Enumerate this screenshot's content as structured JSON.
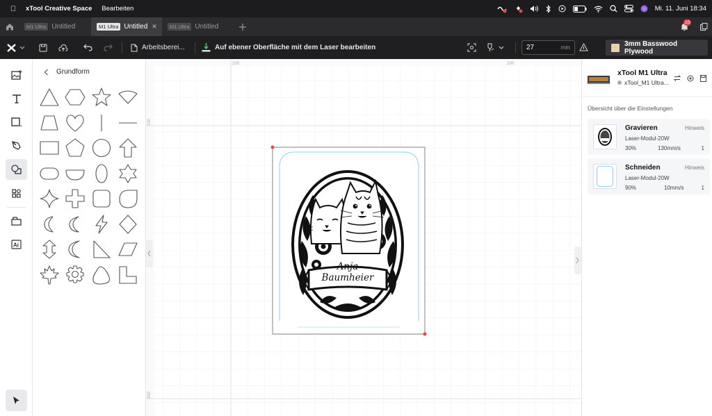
{
  "menubar": {
    "app_name": "xTool Creative Space",
    "menu_edit": "Bearbeiten",
    "clock": "Mi. 11. Juni  18:34"
  },
  "tabs": [
    {
      "badge": "M1 Ultra",
      "label": "Untitled"
    },
    {
      "badge": "M1 Ultra",
      "label": "Untitled",
      "close": "✕"
    },
    {
      "badge": "M1 Ultra",
      "label": "Untitled"
    }
  ],
  "notification_count": "10",
  "toolbar": {
    "workspace_label": "Arbeitsberei...",
    "mode_label": "Auf ebener Oberfläche mit dem Laser bearbeiten",
    "height_value": "27",
    "height_unit": "mm",
    "material_label": "3mm Basswood Plywood",
    "material_color": "#e8d2ad"
  },
  "shape_panel": {
    "title": "Grundform"
  },
  "rulers": {
    "top": [
      "100",
      "200"
    ],
    "left": [
      "100",
      "200"
    ]
  },
  "design": {
    "name_line1": "Anja",
    "name_line2": "Baumheier"
  },
  "device": {
    "name": "xTool M1 Ultra",
    "status": "xTool_M1 Ultra..."
  },
  "settings": {
    "heading": "Übersicht über die Einstellungen",
    "layers": [
      {
        "title": "Gravieren",
        "hint": "Hinweis",
        "module": "Laser-Modul-20W",
        "power": "30%",
        "speed": "130mm/s",
        "passes": "1"
      },
      {
        "title": "Schneiden",
        "hint": "Hinweis",
        "module": "Laser-Modul-20W",
        "power": "90%",
        "speed": "10mm/s",
        "passes": "1"
      }
    ]
  },
  "colors": {
    "accent_red": "#e8474c",
    "cut_outline": "#8fd3f0"
  }
}
